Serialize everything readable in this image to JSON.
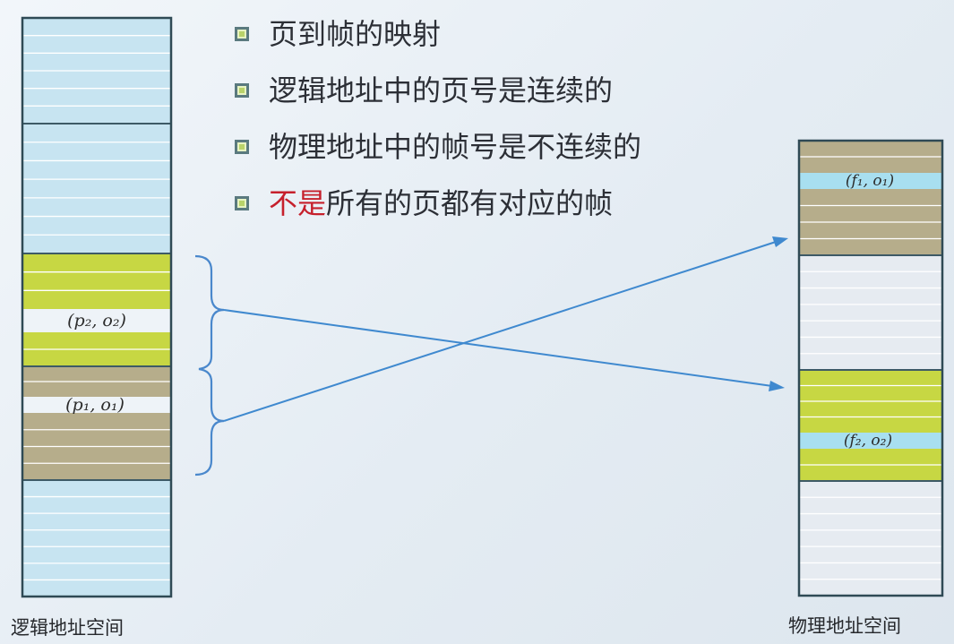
{
  "bullets": [
    {
      "text": "页到帧的映射"
    },
    {
      "text": "逻辑地址中的页号是连续的"
    },
    {
      "text": "物理地址中的帧号是不连续的"
    },
    {
      "highlight": "不是",
      "rest": "所有的页都有对应的帧"
    }
  ],
  "logical_space": {
    "caption": "逻辑地址空间",
    "label_p2": "(p₂, o₂)",
    "label_p1": "(p₁, o₁)"
  },
  "physical_space": {
    "caption": "物理地址空间",
    "label_f1": "(f₁, o₁)",
    "label_f2": "(f₂, o₂)"
  },
  "colors": {
    "blue": "#c7e4f1",
    "yellow_green": "#c7d743",
    "khaki": "#b6ad8b",
    "white": "#eef3f8",
    "cyan": "#a8dff0",
    "gray": "#e6ebf1",
    "line": "#3f89cf",
    "brace": "#4a88cc"
  }
}
